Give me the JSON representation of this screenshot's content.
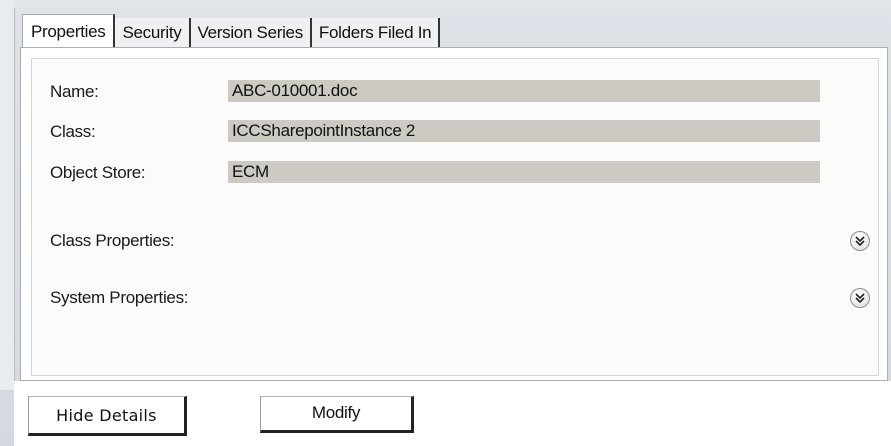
{
  "tabs": [
    {
      "label": "Properties",
      "active": true
    },
    {
      "label": "Security",
      "active": false
    },
    {
      "label": "Version Series",
      "active": false
    },
    {
      "label": "Folders Filed In",
      "active": false
    }
  ],
  "fields": [
    {
      "label": "Name:",
      "value": "ABC-010001.doc"
    },
    {
      "label": "Class:",
      "value": "ICCSharepointInstance 2"
    },
    {
      "label": "Object Store:",
      "value": "ECM"
    }
  ],
  "sections": {
    "class_properties": {
      "label": "Class Properties:",
      "icon": "double-chevron-down-icon"
    },
    "system_properties": {
      "label": "System Properties:",
      "icon": "double-chevron-down-icon"
    }
  },
  "buttons": {
    "hide_details": "Hide Details",
    "modify": "Modify"
  },
  "colors": {
    "field_background": "#cdcac4",
    "panel_background": "#ffffff"
  }
}
